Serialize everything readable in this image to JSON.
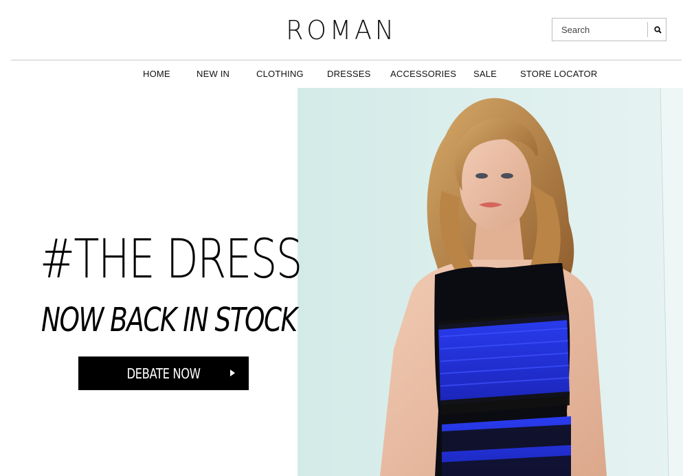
{
  "header": {
    "logo": "ROMAN",
    "search": {
      "placeholder": "Search",
      "value": "",
      "icon": "search-icon"
    }
  },
  "nav": {
    "items": [
      {
        "label": "HOME"
      },
      {
        "label": "NEW IN"
      },
      {
        "label": "CLOTHING"
      },
      {
        "label": "DRESSES"
      },
      {
        "label": "ACCESSORIES"
      },
      {
        "label": "SALE"
      },
      {
        "label": "STORE LOCATOR"
      }
    ]
  },
  "hero": {
    "headline": "#THE DRESS",
    "subheadline": "NOW BACK IN STOCK",
    "cta": {
      "label": "DEBATE NOW",
      "icon": "play-arrow-icon"
    },
    "image": {
      "subject": "model-in-blue-and-black-lace-dress"
    }
  },
  "colors": {
    "dress_blue": "#1f2fd6",
    "lace_black": "#0b0b12",
    "backdrop": "#dff0ee",
    "cta_background": "#000000"
  }
}
